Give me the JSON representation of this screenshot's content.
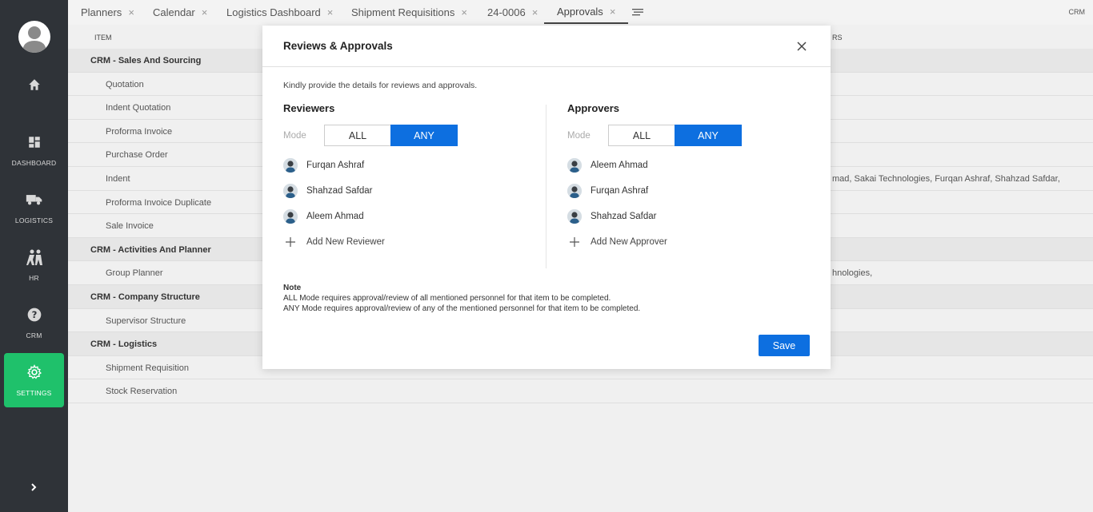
{
  "sidebar": {
    "items": [
      {
        "icon": "home-icon",
        "label": ""
      },
      {
        "icon": "dashboard-icon",
        "label": "DASHBOARD"
      },
      {
        "icon": "truck-icon",
        "label": "LOGISTICS"
      },
      {
        "icon": "people-icon",
        "label": "HR"
      },
      {
        "icon": "help-icon",
        "label": "CRM"
      },
      {
        "icon": "gear-icon",
        "label": "SETTINGS"
      }
    ],
    "accent": "#1fc16b"
  },
  "tabs": [
    {
      "label": "Planners"
    },
    {
      "label": "Calendar"
    },
    {
      "label": "Logistics Dashboard"
    },
    {
      "label": "Shipment Requisitions"
    },
    {
      "label": "24-0006"
    },
    {
      "label": "Approvals"
    }
  ],
  "topbar": {
    "module": "CRM"
  },
  "table": {
    "headers": {
      "item": "ITEM",
      "others": "RS"
    },
    "rows": [
      {
        "label": "CRM - Sales And Sourcing",
        "group": true,
        "ext": ""
      },
      {
        "label": "Quotation",
        "group": false,
        "ext": ""
      },
      {
        "label": "Indent Quotation",
        "group": false,
        "ext": ""
      },
      {
        "label": "Proforma Invoice",
        "group": false,
        "ext": ""
      },
      {
        "label": "Purchase Order",
        "group": false,
        "ext": ""
      },
      {
        "label": "Indent",
        "group": false,
        "ext": "mad, Sakai Technologies, Furqan Ashraf, Shahzad Safdar,"
      },
      {
        "label": "Proforma Invoice Duplicate",
        "group": false,
        "ext": ""
      },
      {
        "label": "Sale Invoice",
        "group": false,
        "ext": ""
      },
      {
        "label": "CRM - Activities And Planner",
        "group": true,
        "ext": ""
      },
      {
        "label": "Group Planner",
        "group": false,
        "ext": "hnologies,"
      },
      {
        "label": "CRM - Company Structure",
        "group": true,
        "ext": ""
      },
      {
        "label": "Supervisor Structure",
        "group": false,
        "ext": ""
      },
      {
        "label": "CRM - Logistics",
        "group": true,
        "ext": ""
      },
      {
        "label": "Shipment Requisition",
        "group": false,
        "ext": ""
      },
      {
        "label": "Stock Reservation",
        "group": false,
        "ext": ""
      }
    ]
  },
  "modal": {
    "title": "Reviews & Approvals",
    "intro": "Kindly provide the details for reviews and approvals.",
    "reviewers": {
      "title": "Reviewers",
      "mode_label": "Mode",
      "mode_all": "ALL",
      "mode_any": "ANY",
      "people": [
        "Furqan Ashraf",
        "Shahzad Safdar",
        "Aleem Ahmad"
      ],
      "add_label": "Add New Reviewer"
    },
    "approvers": {
      "title": "Approvers",
      "mode_label": "Mode",
      "mode_all": "ALL",
      "mode_any": "ANY",
      "people": [
        "Aleem Ahmad",
        "Furqan Ashraf",
        "Shahzad Safdar"
      ],
      "add_label": "Add New Approver"
    },
    "note": {
      "title": "Note",
      "line1": "ALL Mode requires approval/review of all mentioned personnel for that item to be completed.",
      "line2": "ANY Mode requires approval/review of any of the mentioned personnel for that item to be completed."
    },
    "save_label": "Save",
    "accent": "#0d6fe0"
  }
}
